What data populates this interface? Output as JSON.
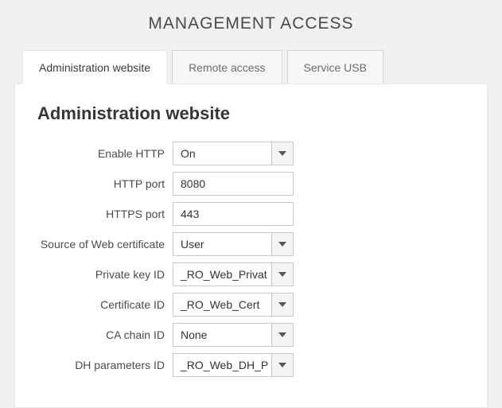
{
  "page_title": "MANAGEMENT ACCESS",
  "tabs": {
    "admin": "Administration website",
    "remote": "Remote access",
    "service_usb": "Service USB"
  },
  "section_title": "Administration website",
  "form": {
    "enable_http": {
      "label": "Enable HTTP",
      "value": "On"
    },
    "http_port": {
      "label": "HTTP port",
      "value": "8080"
    },
    "https_port": {
      "label": "HTTPS port",
      "value": "443"
    },
    "web_cert_src": {
      "label": "Source of Web certificate",
      "value": "User"
    },
    "private_key_id": {
      "label": "Private key ID",
      "value": "_RO_Web_Privat"
    },
    "certificate_id": {
      "label": "Certificate ID",
      "value": "_RO_Web_Cert"
    },
    "ca_chain_id": {
      "label": "CA chain ID",
      "value": "None"
    },
    "dh_params_id": {
      "label": "DH parameters ID",
      "value": "_RO_Web_DH_P"
    }
  }
}
